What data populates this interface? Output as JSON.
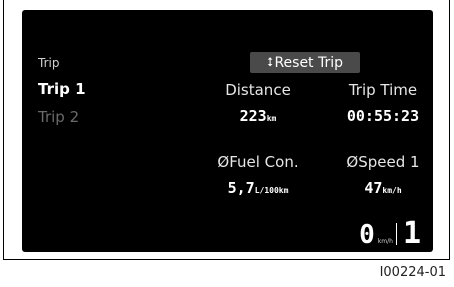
{
  "sidebar": {
    "header": "Trip",
    "items": [
      {
        "label": "Trip 1",
        "active": true
      },
      {
        "label": "Trip 2",
        "active": false
      }
    ]
  },
  "reset_button": {
    "label": "Reset Trip",
    "icon": "up-down-arrow-icon"
  },
  "metrics": {
    "distance": {
      "label": "Distance",
      "value": "223",
      "unit": "km"
    },
    "trip_time": {
      "label": "Trip Time",
      "value": "00:55:23"
    },
    "fuel": {
      "label": "ØFuel Con.",
      "value": "5,7",
      "unit": "L/100km"
    },
    "speed": {
      "label": "ØSpeed 1",
      "value": "47",
      "unit": "km/h"
    }
  },
  "status": {
    "current_speed": "0",
    "speed_unit": "km/h",
    "gear": "1"
  },
  "figure_id": "I00224-01",
  "colors": {
    "screen_bg": "#000000",
    "button_bg": "#4a4a4a",
    "inactive_text": "#6a6a6a"
  }
}
